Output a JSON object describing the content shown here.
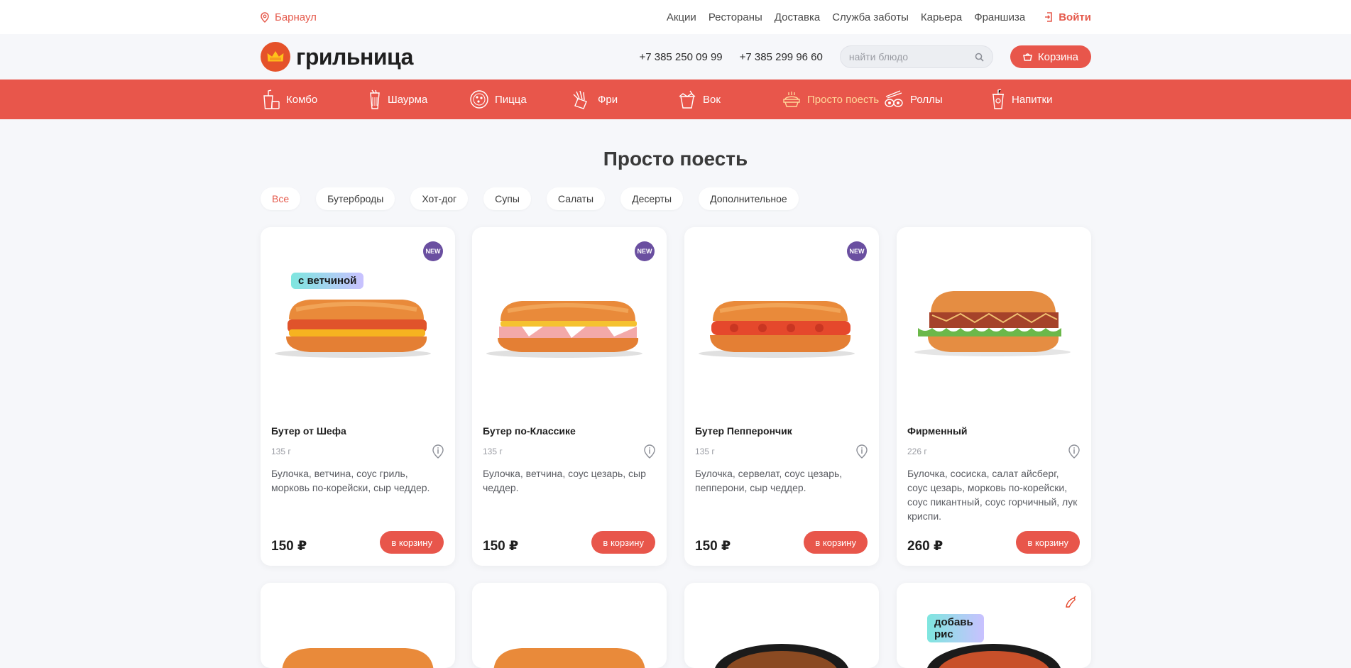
{
  "topbar": {
    "city": "Барнаул",
    "nav": [
      "Акции",
      "Рестораны",
      "Доставка",
      "Служба заботы",
      "Карьера",
      "Франшиза"
    ],
    "login": "Войти"
  },
  "header": {
    "logo_text": "грильница",
    "phone1": "+7 385 250 09 99",
    "phone2": "+7 385 299 96 60",
    "search_placeholder": "найти блюдо",
    "cart_label": "Корзина"
  },
  "categories": [
    {
      "label": "Комбо",
      "icon": "combo-icon"
    },
    {
      "label": "Шаурма",
      "icon": "shawarma-icon"
    },
    {
      "label": "Пицца",
      "icon": "pizza-icon"
    },
    {
      "label": "Фри",
      "icon": "fries-icon"
    },
    {
      "label": "Вок",
      "icon": "wok-icon"
    },
    {
      "label": "Просто поесть",
      "icon": "just-eat-icon",
      "active": true
    },
    {
      "label": "Роллы",
      "icon": "rolls-icon"
    },
    {
      "label": "Напитки",
      "icon": "drinks-icon"
    }
  ],
  "section": {
    "title": "Просто поесть",
    "filters": [
      "Все",
      "Бутерброды",
      "Хот-дог",
      "Супы",
      "Салаты",
      "Десерты",
      "Дополнительное"
    ],
    "active_filter": "Все"
  },
  "products": [
    {
      "name": "Бутер от Шефа",
      "weight": "135 г",
      "desc": "Булочка, ветчина, соус гриль, морковь по-корейски, сыр чеддер.",
      "price": "150 ₽",
      "button": "в корзину",
      "badge": "NEW",
      "promo": "с ветчиной"
    },
    {
      "name": "Бутер по-Классике",
      "weight": "135 г",
      "desc": "Булочка, ветчина, соус цезарь, сыр чеддер.",
      "price": "150 ₽",
      "button": "в корзину",
      "badge": "NEW"
    },
    {
      "name": "Бутер Пепперончик",
      "weight": "135 г",
      "desc": "Булочка, сервелат, соус цезарь, пепперони, сыр чеддер.",
      "price": "150 ₽",
      "button": "в корзину",
      "badge": "NEW"
    },
    {
      "name": "Фирменный",
      "weight": "226 г",
      "desc": "Булочка, сосиска, салат айсберг, соус цезарь, морковь по-корейски, соус пикантный, соус горчичный, лук криспи.",
      "price": "260 ₽",
      "button": "в корзину"
    }
  ],
  "row2": {
    "promo": "добавь рис",
    "spicy_icon": "chili-icon"
  },
  "colors": {
    "accent": "#e8564b",
    "active_category": "#ffd79a",
    "badge_new": "#6a4fa0",
    "logo": "#e5522a"
  }
}
